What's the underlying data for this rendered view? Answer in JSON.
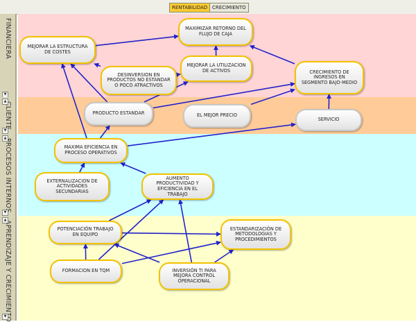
{
  "tabs": [
    "RENTABILIDAD",
    "CRECIMIENTO"
  ],
  "perspectives": [
    {
      "label": "FINANCIERA",
      "color": "#ffd5d5"
    },
    {
      "label": "CLIENTE",
      "color": "#ffcc99"
    },
    {
      "label": "PROCESOS INTERNOS",
      "color": "#ccffff"
    },
    {
      "label": "APRENDIZAJE Y CRECIMIENTO",
      "color": "#ffffcc"
    }
  ],
  "objectives": {
    "estructura_costes": "MEJORAR LA ESTRUCTURA DE COSTES",
    "retorno_caja": "MAXIMIZAR RETORNO DEL FLUJO DE CAJA",
    "desinversion": "DESINVERSION EN PRODUCTOS NO ESTANDAR O POCO ATRACTIVOS",
    "utilizacion_activos": "MEJORAR LA UTILIZACION DE ACTIVOS",
    "crecimiento_ingresos": "CRECIMIENTO DE INGRESOS EN SEGMENTO BAJO-MEDIO",
    "producto_estandar": "PRODUCTO ESTANDAR",
    "mejor_precio": "EL MEJOR PRECIO",
    "servicio": "SERVICIO",
    "eficiencia_procesos": "MAXIMA EFICIENCIA EN PROCESO OPERATIVOS",
    "externalizacion": "EXTERNALIZACION DE ACTIVIDADES SECUNDARIAS",
    "productividad": "AUMENTO PRODUCTIVIDAD Y EFICIENCIA EN EL TRABAJO",
    "trabajo_equipo": "POTENCIACIÓN TRABAJO EN EQUIPO",
    "estandarizacion": "ESTANDARIZACIÓN DE METODOLOGIAS Y PROCEDIMIENTOS",
    "formacion_tqm": "FORMACION EN TQM",
    "inversion_ti": "INVERSIÓN TI PARA MEJORA CONTROL OPERACIONAL"
  },
  "colors": {
    "link": "#2222cc",
    "node_border": "#f2c200",
    "grey_border": "#c8c8c8"
  },
  "links": [
    [
      "estructura_costes",
      "retorno_caja"
    ],
    [
      "utilizacion_activos",
      "retorno_caja"
    ],
    [
      "crecimiento_ingresos",
      "retorno_caja"
    ],
    [
      "desinversion",
      "estructura_costes"
    ],
    [
      "desinversion",
      "utilizacion_activos"
    ],
    [
      "producto_estandar",
      "estructura_costes"
    ],
    [
      "producto_estandar",
      "crecimiento_ingresos"
    ],
    [
      "producto_estandar",
      "utilizacion_activos"
    ],
    [
      "mejor_precio",
      "crecimiento_ingresos"
    ],
    [
      "servicio",
      "crecimiento_ingresos"
    ],
    [
      "eficiencia_procesos",
      "estructura_costes"
    ],
    [
      "eficiencia_procesos",
      "producto_estandar"
    ],
    [
      "eficiencia_procesos",
      "servicio"
    ],
    [
      "externalizacion",
      "eficiencia_procesos"
    ],
    [
      "productividad",
      "eficiencia_procesos"
    ],
    [
      "trabajo_equipo",
      "productividad"
    ],
    [
      "trabajo_equipo",
      "estandarizacion"
    ],
    [
      "formacion_tqm",
      "trabajo_equipo"
    ],
    [
      "formacion_tqm",
      "productividad"
    ],
    [
      "formacion_tqm",
      "estandarizacion"
    ],
    [
      "inversion_ti",
      "productividad"
    ],
    [
      "inversion_ti",
      "trabajo_equipo"
    ],
    [
      "inversion_ti",
      "estandarizacion"
    ]
  ]
}
